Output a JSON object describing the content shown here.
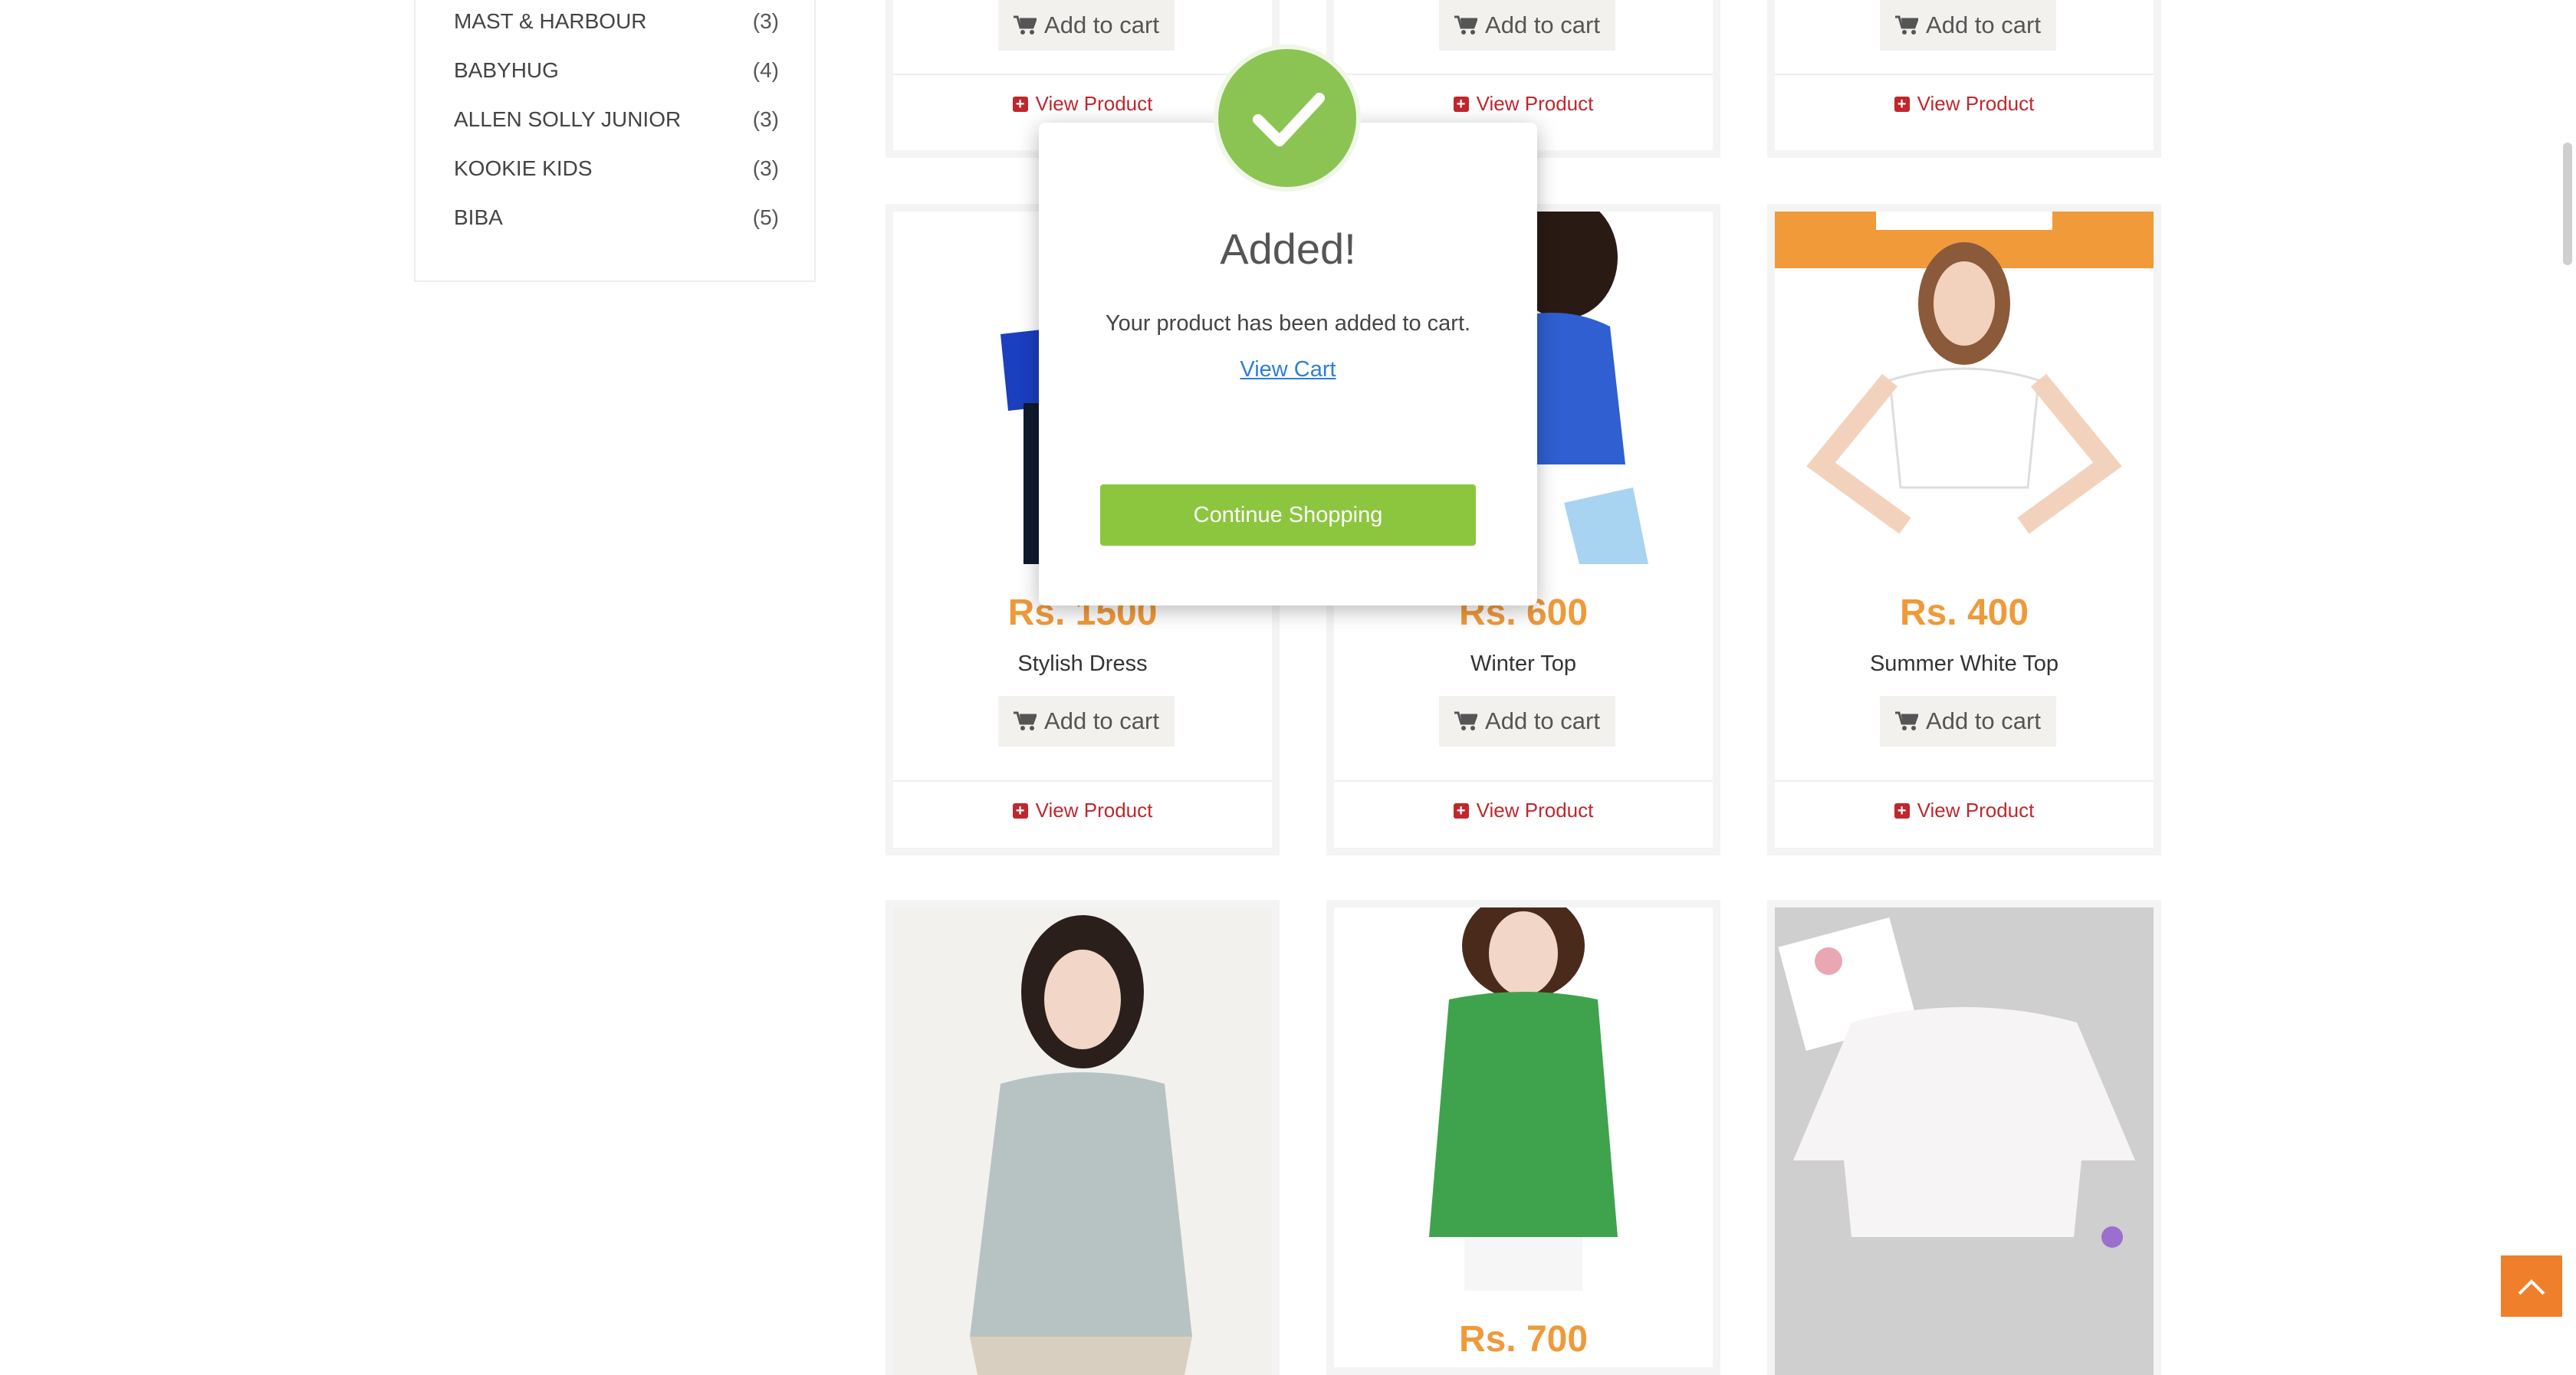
{
  "sidebar": {
    "brands": [
      {
        "name": "MAST & HARBOUR",
        "count": "(3)"
      },
      {
        "name": "BABYHUG",
        "count": "(4)"
      },
      {
        "name": "ALLEN SOLLY JUNIOR",
        "count": "(3)"
      },
      {
        "name": "KOOKIE KIDS",
        "count": "(3)"
      },
      {
        "name": "BIBA",
        "count": "(5)"
      }
    ]
  },
  "common": {
    "add_to_cart": "Add to cart",
    "view_product": "View Product",
    "cart_icon": "cart-icon",
    "plus_icon": "plus-square-icon"
  },
  "products": {
    "row1": [
      {
        "id": "p1"
      },
      {
        "id": "p2"
      },
      {
        "id": "p3"
      }
    ],
    "row2": [
      {
        "price": "Rs. 1500",
        "name": "Stylish Dress"
      },
      {
        "price": "Rs. 600",
        "name": "Winter Top"
      },
      {
        "price": "Rs. 400",
        "name": "Summer White Top"
      }
    ],
    "row3": [
      {
        "price": ""
      },
      {
        "price": "Rs. 700"
      },
      {
        "price": ""
      }
    ]
  },
  "modal": {
    "icon": "checkmark-icon",
    "title": "Added!",
    "message": "Your product has been added to cart.",
    "link": "View Cart",
    "button": "Continue Shopping"
  },
  "colors": {
    "price": "#ef9a3a",
    "success": "#8cc453",
    "link": "#c0272d",
    "scroll_top": "#ef7f2a"
  }
}
